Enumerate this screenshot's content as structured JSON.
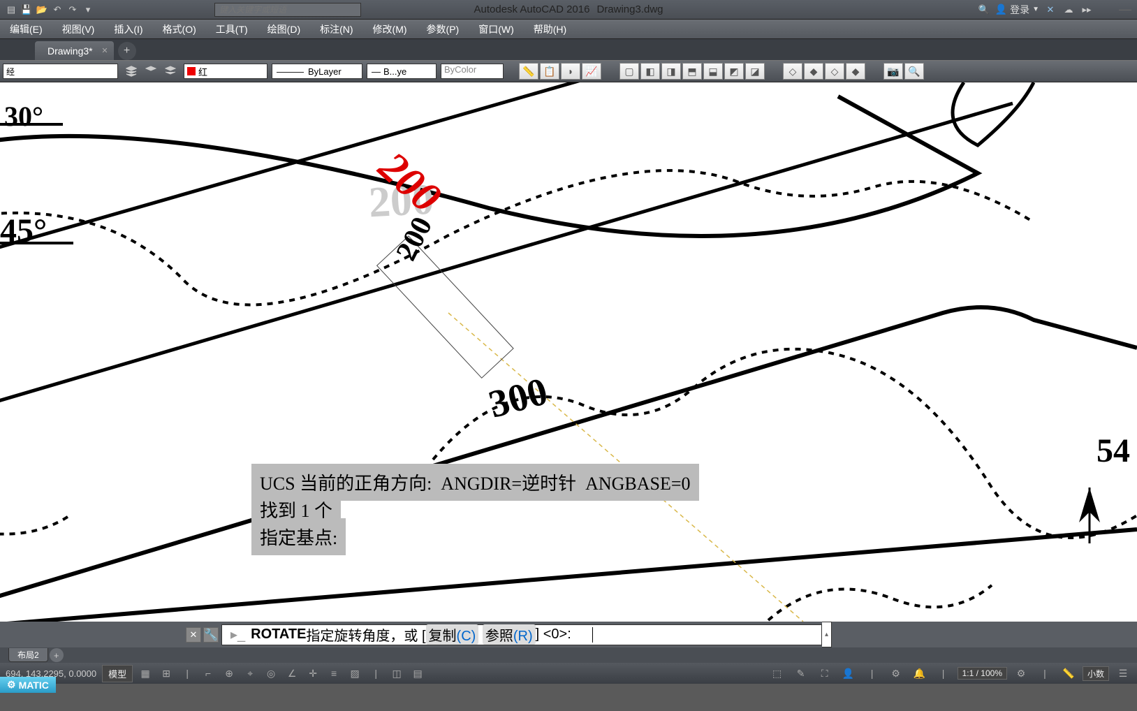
{
  "title": {
    "app": "Autodesk AutoCAD 2016",
    "doc": "Drawing3.dwg",
    "search_ph": "键入关键字或短语",
    "login": "登录"
  },
  "menu": [
    "编辑(E)",
    "视图(V)",
    "插入(I)",
    "格式(O)",
    "工具(T)",
    "绘图(D)",
    "标注(N)",
    "修改(M)",
    "参数(P)",
    "窗口(W)",
    "帮助(H)"
  ],
  "doctab": {
    "name": "Drawing3*"
  },
  "toolbar": {
    "layer_ph": "经",
    "color_label": "红",
    "linetype": "ByLayer",
    "lineweight": "B...ye",
    "plotstyle": "ByColor"
  },
  "canvas": {
    "labels": {
      "l30": "30°",
      "l45": "45°",
      "c200_red": "200",
      "c200_bg": "200",
      "c200": "200",
      "c300": "300",
      "c54": "54"
    },
    "overlay1": "UCS 当前的正角方向:  ANGDIR=逆时针  ANGBASE=0",
    "overlay2": "找到 1 个",
    "overlay3": "指定基点:"
  },
  "cmd": {
    "verb": "ROTATE",
    "prompt": " 指定旋转角度，或 [",
    "opt1": "复制",
    "opt1k": "(C)",
    "opt2": "参照",
    "opt2k": "(R)",
    "tail": "] <0>: "
  },
  "layout": {
    "tab2": "布局2"
  },
  "status": {
    "watermark": "MATIC",
    "coords": "694, 143.2295, 0.0000",
    "model": "模型",
    "zoom": "1:1 / 100%",
    "units": "小数"
  }
}
